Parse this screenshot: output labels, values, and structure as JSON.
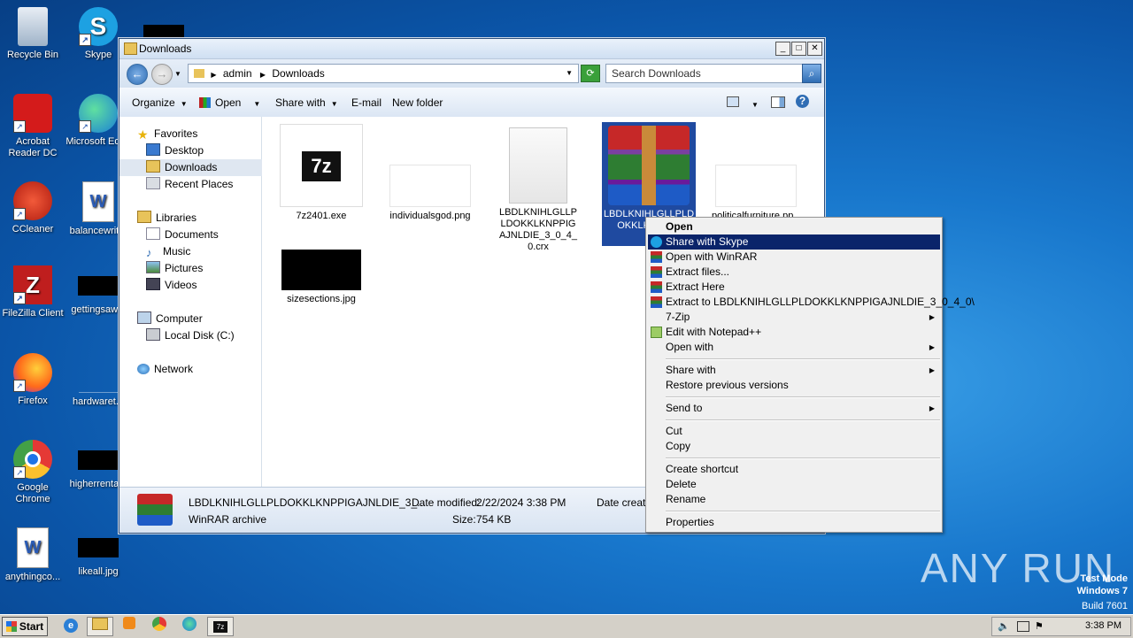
{
  "desktop": {
    "icons": [
      {
        "label": "Recycle Bin"
      },
      {
        "label": "Skype"
      },
      {
        "label": "Acrobat Reader DC"
      },
      {
        "label": "Microsoft Edge"
      },
      {
        "label": "CCleaner"
      },
      {
        "label": "balancewrit..."
      },
      {
        "label": "FileZilla Client"
      },
      {
        "label": "gettingsaw..."
      },
      {
        "label": "Firefox"
      },
      {
        "label": "hardwaret..."
      },
      {
        "label": "Google Chrome"
      },
      {
        "label": "higherrenta..."
      },
      {
        "label": "anythingco..."
      },
      {
        "label": "likeall.jpg"
      }
    ]
  },
  "window": {
    "title": "Downloads",
    "address": {
      "crumb1": "admin",
      "crumb2": "Downloads"
    },
    "search_placeholder": "Search Downloads",
    "commands": {
      "organize": "Organize",
      "open": "Open",
      "share_with": "Share with",
      "email": "E-mail",
      "new_folder": "New folder"
    },
    "nav": {
      "favorites": "Favorites",
      "desktop": "Desktop",
      "downloads": "Downloads",
      "recent": "Recent Places",
      "libraries": "Libraries",
      "documents": "Documents",
      "music": "Music",
      "pictures": "Pictures",
      "videos": "Videos",
      "computer": "Computer",
      "local_disk": "Local Disk (C:)",
      "network": "Network"
    },
    "files": [
      {
        "name": "7z2401.exe"
      },
      {
        "name": "individualsgod.png"
      },
      {
        "name": "LBDLKNIHLGLLPLDOKKLKNPPIGAJNLDIE_3_0_4_0.crx"
      },
      {
        "name": "LBDLKNIHLGLLPLDOKKLKNPPI..."
      },
      {
        "name": "politicalfurniture.pp..."
      },
      {
        "name": "sizesections.jpg"
      }
    ],
    "details": {
      "name": "LBDLKNIHLGLLPLDOKKLKNPPIGAJNLDIE_3_...",
      "type": "WinRAR archive",
      "date_modified_label": "Date modified:",
      "date_modified": "2/22/2024 3:38 PM",
      "size_label": "Size:",
      "size": "754 KB",
      "date_created_label": "Date create"
    }
  },
  "context_menu": {
    "open": "Open",
    "share_skype": "Share with Skype",
    "open_winrar": "Open with WinRAR",
    "extract_files": "Extract files...",
    "extract_here": "Extract Here",
    "extract_to": "Extract to LBDLKNIHLGLLPLDOKKLKNPPIGAJNLDIE_3_0_4_0\\",
    "sevenzip": "7-Zip",
    "edit_npp": "Edit with Notepad++",
    "open_with": "Open with",
    "share_with": "Share with",
    "restore": "Restore previous versions",
    "send_to": "Send to",
    "cut": "Cut",
    "copy": "Copy",
    "create_shortcut": "Create shortcut",
    "delete": "Delete",
    "rename": "Rename",
    "properties": "Properties"
  },
  "taskbar": {
    "start": "Start",
    "clock": "3:38 PM"
  },
  "watermark": {
    "line1": "Test Mode",
    "line2": "Windows 7",
    "line3": "Build 7601",
    "brand": "ANY RUN"
  }
}
